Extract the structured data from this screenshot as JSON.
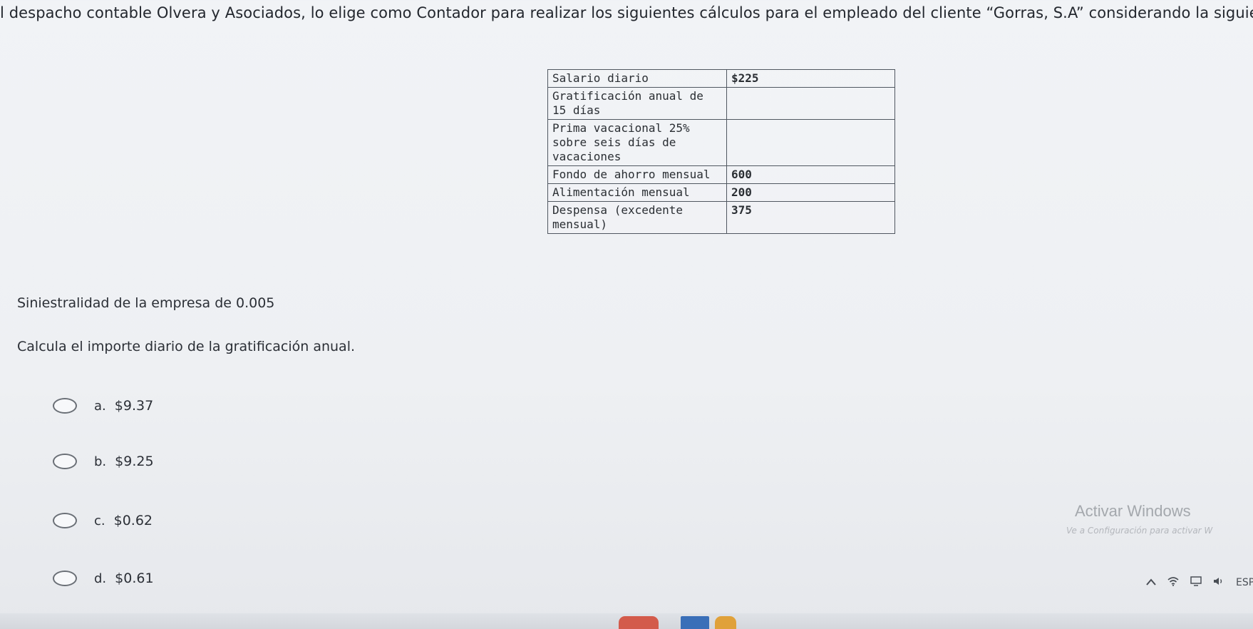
{
  "intro": "l despacho contable Olvera y Asociados, lo elige como Contador para realizar los siguientes cálculos para el empleado del cliente “Gorras, S.A” considerando la siguiente informació",
  "table": [
    {
      "label": "Salario diario",
      "value": "$225"
    },
    {
      "label": "Gratificación anual de 15 días",
      "value": ""
    },
    {
      "label": "Prima vacacional 25% sobre seis días de vacaciones",
      "value": ""
    },
    {
      "label": "Fondo de ahorro mensual",
      "value": "600"
    },
    {
      "label": "Alimentación mensual",
      "value": "200"
    },
    {
      "label": "Despensa (excedente mensual)",
      "value": "375"
    }
  ],
  "siniestralidad": "Siniestralidad de la empresa de 0.005",
  "question": "Calcula el importe diario de la gratificación anual.",
  "options": [
    {
      "letter": "a.",
      "text": "$9.37"
    },
    {
      "letter": "b.",
      "text": "$9.25"
    },
    {
      "letter": "c.",
      "text": "$0.62"
    },
    {
      "letter": "d.",
      "text": "$0.61"
    }
  ],
  "watermark": {
    "title": "Activar Windows",
    "subtitle": "Ve a Configuración para activar W"
  },
  "tray": {
    "language": "ESP"
  },
  "icons": {
    "wifi": "wifi-icon",
    "volume": "volume-icon",
    "chevron": "chevron-up-icon"
  }
}
